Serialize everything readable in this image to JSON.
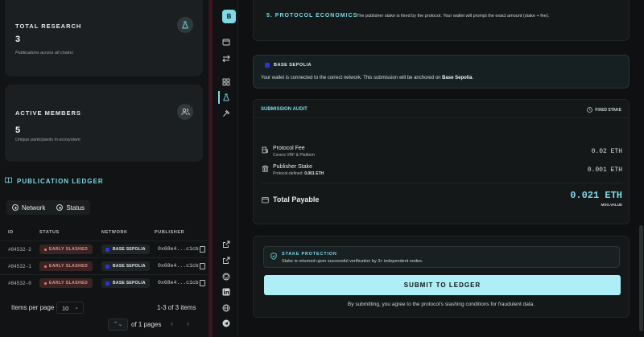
{
  "stats": [
    {
      "label": "TOTAL RESEARCH",
      "value": "3",
      "sub": "Publications across all chains",
      "icon": "flask-icon"
    },
    {
      "label": "ACTIVE MEMBERS",
      "value": "5",
      "sub": "Unique participants in ecosystem",
      "icon": "users-icon"
    }
  ],
  "ledger": {
    "title": "PUBLICATION LEDGER",
    "filters": [
      "Network",
      "Status"
    ],
    "columns": [
      "ID",
      "STATUS",
      "NETWORK",
      "PUBLISHER"
    ],
    "rows": [
      {
        "id": "#84532-2",
        "status": "EARLY SLASHED",
        "network": "BASE SEPOLIA",
        "publisher": "0x68e4...c1cb"
      },
      {
        "id": "#84532-1",
        "status": "EARLY SLASHED",
        "network": "BASE SEPOLIA",
        "publisher": "0x68e4...c1cb"
      },
      {
        "id": "#84532-0",
        "status": "EARLY SLASHED",
        "network": "BASE SEPOLIA",
        "publisher": "0x68e4...c1cb"
      }
    ],
    "items_per_page_label": "Items per page",
    "items_per_page": "10",
    "range": "1-3 of 3 items",
    "page": "1",
    "of_pages": "of 1 pages"
  },
  "rail": {
    "logo": "B",
    "icons": [
      "wallet-icon",
      "swap-icon",
      "grid-icon",
      "flask-icon",
      "hammer-icon",
      "external-link-icon",
      "external-link-icon",
      "github-icon",
      "linkedin-icon",
      "globe-icon",
      "telegram-icon"
    ],
    "active": "flask-icon"
  },
  "economics": {
    "heading": "5. PROTOCOL ECONOMICS",
    "text": "The publisher stake is fixed by the protocol. Your wallet will prompt the exact amount (stake + fee)."
  },
  "network_notice": {
    "network": "BASE SEPOLIA",
    "message_pre": "Your wallet is connected to the correct network. This submission will be anchored on ",
    "message_net": "Base Sepolia",
    "message_post": "."
  },
  "audit": {
    "title": "SUBMISSION AUDIT",
    "badge": "FIXED STAKE",
    "fee_name": "Protocol Fee",
    "fee_desc": "Covers VRF & Platform",
    "fee_value": "0.02 ETH",
    "stake_name": "Publisher Stake",
    "stake_desc_pre": "Protocol-defined: ",
    "stake_desc_val": "0.001 ETH",
    "stake_value": "0.001 ETH",
    "total_name": "Total Payable",
    "total_value": "0.021 ETH",
    "total_note": "MSG.VALUE"
  },
  "submit": {
    "protection_title": "STAKE PROTECTION",
    "protection_text": "Stake is returned upon successful verification by 3+ independent nodes.",
    "button": "SUBMIT TO LEDGER",
    "fine": "By submitting, you agree to the protocol's slashing conditions for fraudulent data."
  },
  "colors": {
    "accent": "#7fd9e6",
    "button": "#aeeef6",
    "slashed": "#e59a93",
    "network": "#2a35d4"
  }
}
